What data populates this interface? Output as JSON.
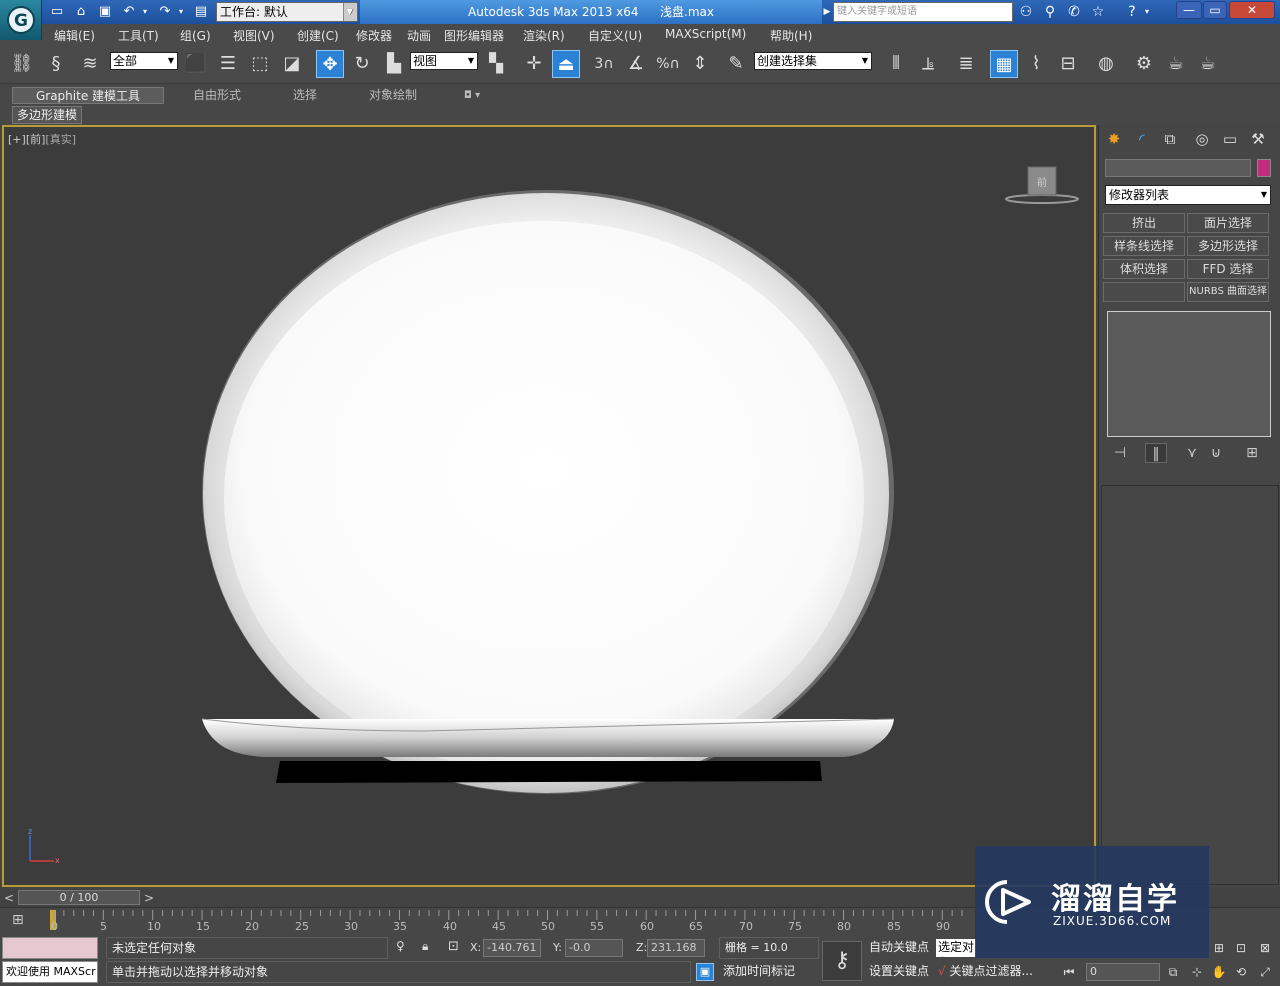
{
  "title_bar": {
    "workspace_label": "工作台: 默认",
    "app_title": "Autodesk 3ds Max  2013 x64",
    "filename": "浅盘.max",
    "search_placeholder": "键入关键字或短语",
    "minimize": "—",
    "restore": "▭",
    "close": "✕"
  },
  "menu": [
    "编辑(E)",
    "工具(T)",
    "组(G)",
    "视图(V)",
    "创建(C)",
    "修改器",
    "动画",
    "图形编辑器",
    "渲染(R)",
    "自定义(U)",
    "MAXScript(M)",
    "帮助(H)"
  ],
  "toolbar": {
    "selection_filter": "全部",
    "ref_coord": "视图",
    "named_selection": "创建选择集",
    "snap_labels": [
      "3",
      "%"
    ]
  },
  "ribbon": {
    "tabs": [
      "Graphite 建模工具",
      "自由形式",
      "选择",
      "对象绘制"
    ],
    "sub_label": "多边形建模"
  },
  "viewport": {
    "label_plus": "[+]",
    "label_view": "[前]",
    "label_shading": "[真实]",
    "viewcube_label": "前",
    "axis_z": "z",
    "axis_x": "x"
  },
  "command_panel": {
    "modifier_list": "修改器列表",
    "buttons": [
      "挤出",
      "面片选择",
      "样条线选择",
      "多边形选择",
      "体积选择",
      "FFD 选择",
      "",
      "NURBS 曲面选择"
    ],
    "colors": {
      "object_color": "#c12d7c"
    }
  },
  "timeline": {
    "slider_text": "0 / 100",
    "prev": "<",
    "next": ">",
    "ticks": [
      "0",
      "5",
      "10",
      "15",
      "20",
      "25",
      "30",
      "35",
      "40",
      "45",
      "50",
      "55",
      "60",
      "65",
      "70",
      "75",
      "80",
      "85",
      "90"
    ]
  },
  "status": {
    "maxscript_welcome": "欢迎使用 MAXScr",
    "selection": "未选定任何对象",
    "prompt": "单击并拖动以选择并移动对象",
    "x_label": "X:",
    "x_value": "-140.761",
    "y_label": "Y:",
    "y_value": "-0.0",
    "z_label": "Z:",
    "z_value": "231.168",
    "grid": "栅格 = 10.0",
    "add_time_tag": "添加时间标记",
    "auto_key": "自动关键点",
    "set_key": "设置关键点",
    "selected_dropdown": "选定对象",
    "key_filter": "关键点过滤器...",
    "frame": "0"
  },
  "watermark": {
    "title": "溜溜自学",
    "subtitle": "ZIXUE.3D66.COM"
  }
}
